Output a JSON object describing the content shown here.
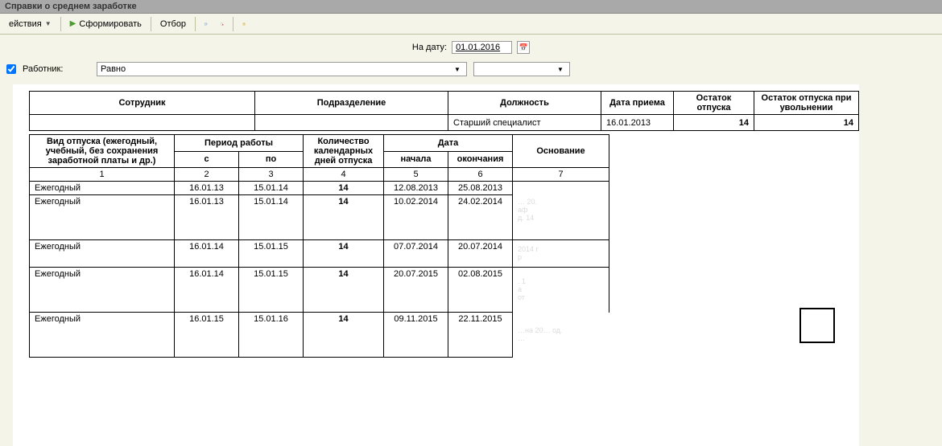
{
  "window": {
    "title": "Справки о среднем заработке"
  },
  "toolbar": {
    "actions_label": "ействия",
    "run_label": "Сформировать",
    "filter_label": "Отбор"
  },
  "date_filter": {
    "label": "На дату:",
    "value": "01.01.2016"
  },
  "worker_filter": {
    "checked": true,
    "label": "Работник:",
    "op": "Равно"
  },
  "summary_header": {
    "c1": "Сотрудник",
    "c2": "Подразделение",
    "c3": "Должность",
    "c4": "Дата приема",
    "c5": "Остаток отпуска",
    "c6": "Остаток отпуска при увольнении"
  },
  "summary_row": {
    "position": "Старший специалист",
    "hire_date": "16.01.2013",
    "rest": "14",
    "rest_fire": "14"
  },
  "detail_header": {
    "type": "Вид отпуска (ежегодный, учебный, без сохранения заработной платы и др.)",
    "period": "Период работы",
    "from": "с",
    "to": "по",
    "days": "Количество календарных дней отпуска",
    "date": "Дата",
    "date_from": "начала",
    "date_to": "окончания",
    "basis": "Основание",
    "n1": "1",
    "n2": "2",
    "n3": "3",
    "n4": "4",
    "n5": "5",
    "n6": "6",
    "n7": "7"
  },
  "detail_rows": [
    {
      "type": "Ежегодный",
      "from": "16.01.13",
      "to": "15.01.14",
      "days": "14",
      "dfrom": "12.08.2013",
      "dto": "25.08.2013"
    },
    {
      "type": "Ежегодный",
      "from": "16.01.13",
      "to": "15.01.14",
      "days": "14",
      "dfrom": "10.02.2014",
      "dto": "24.02.2014"
    },
    {
      "type": "Ежегодный",
      "from": "16.01.14",
      "to": "15.01.15",
      "days": "14",
      "dfrom": "07.07.2014",
      "dto": "20.07.2014"
    },
    {
      "type": "Ежегодный",
      "from": "16.01.14",
      "to": "15.01.15",
      "days": "14",
      "dfrom": "20.07.2015",
      "dto": "02.08.2015"
    },
    {
      "type": "Ежегодный",
      "from": "16.01.15",
      "to": "15.01.16",
      "days": "14",
      "dfrom": "09.11.2015",
      "dto": "22.11.2015"
    }
  ]
}
